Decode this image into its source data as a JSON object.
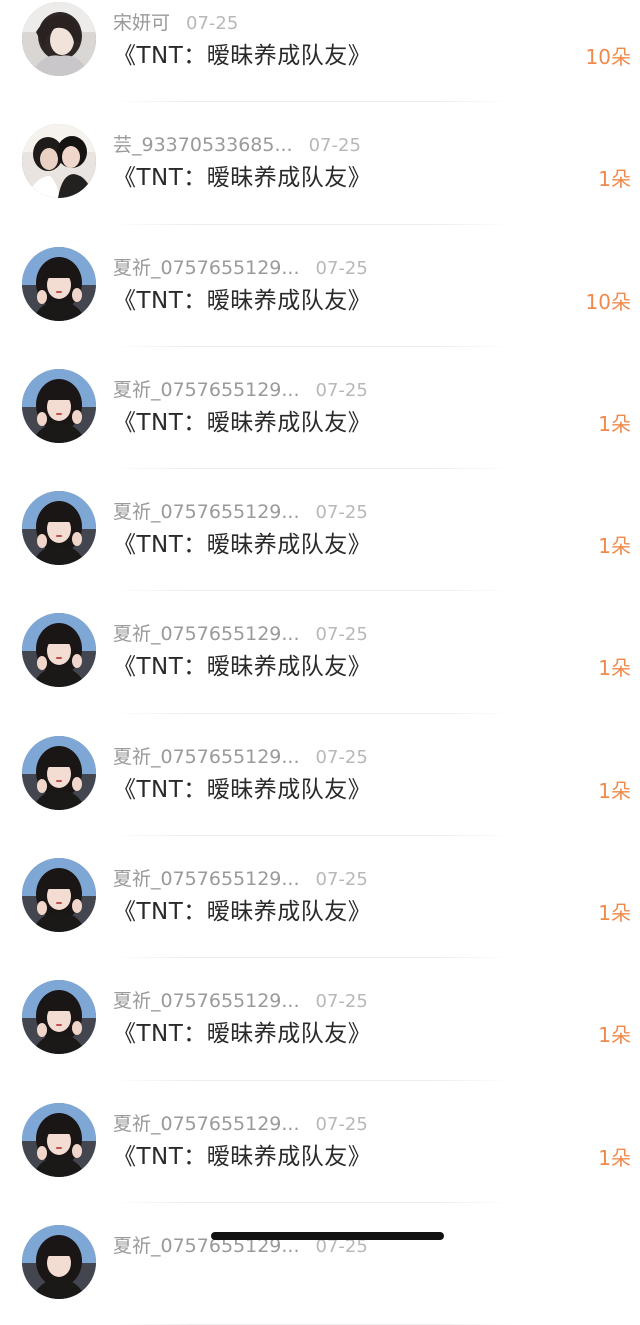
{
  "gift_list": [
    {
      "username": "宋妍可",
      "date": "07-25",
      "title": "《TNT：暧昧养成队友》",
      "count": "10朵",
      "avatar_icon": "avatar-girl-light-icon"
    },
    {
      "username": "芸_93370533685...",
      "date": "07-25",
      "title": "《TNT：暧昧养成队友》",
      "count": "1朵",
      "avatar_icon": "avatar-couple-icon"
    },
    {
      "username": "夏祈_0757655129...",
      "date": "07-25",
      "title": "《TNT：暧昧养成队友》",
      "count": "10朵",
      "avatar_icon": "avatar-girl-peace-icon"
    },
    {
      "username": "夏祈_0757655129...",
      "date": "07-25",
      "title": "《TNT：暧昧养成队友》",
      "count": "1朵",
      "avatar_icon": "avatar-girl-peace-icon"
    },
    {
      "username": "夏祈_0757655129...",
      "date": "07-25",
      "title": "《TNT：暧昧养成队友》",
      "count": "1朵",
      "avatar_icon": "avatar-girl-peace-icon"
    },
    {
      "username": "夏祈_0757655129...",
      "date": "07-25",
      "title": "《TNT：暧昧养成队友》",
      "count": "1朵",
      "avatar_icon": "avatar-girl-peace-icon"
    },
    {
      "username": "夏祈_0757655129...",
      "date": "07-25",
      "title": "《TNT：暧昧养成队友》",
      "count": "1朵",
      "avatar_icon": "avatar-girl-peace-icon"
    },
    {
      "username": "夏祈_0757655129...",
      "date": "07-25",
      "title": "《TNT：暧昧养成队友》",
      "count": "1朵",
      "avatar_icon": "avatar-girl-peace-icon"
    },
    {
      "username": "夏祈_0757655129...",
      "date": "07-25",
      "title": "《TNT：暧昧养成队友》",
      "count": "1朵",
      "avatar_icon": "avatar-girl-peace-icon"
    },
    {
      "username": "夏祈_0757655129...",
      "date": "07-25",
      "title": "《TNT：暧昧养成队友》",
      "count": "1朵",
      "avatar_icon": "avatar-girl-peace-icon"
    },
    {
      "username": "夏祈_0757655129...",
      "date": "07-25",
      "title": "",
      "count": "",
      "avatar_icon": "avatar-girl-peace-icon"
    }
  ],
  "colors": {
    "count_accent": "#f08a4b",
    "username_gray": "#9a9a9a",
    "title_text": "#2a2a2a"
  }
}
